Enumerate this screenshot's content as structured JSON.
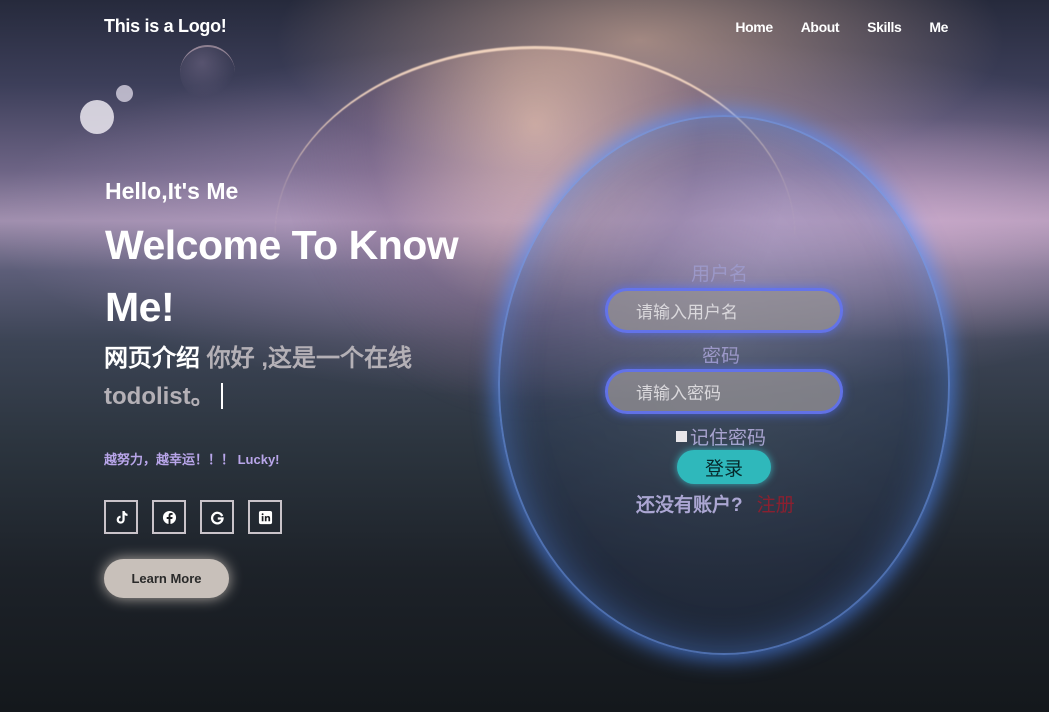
{
  "header": {
    "logo": "This is a Logo!",
    "nav": [
      "Home",
      "About",
      "Skills",
      "Me"
    ]
  },
  "hero": {
    "greeting": "Hello,It's Me",
    "title": "Welcome To Know Me!",
    "intro_label": "网页介绍",
    "intro_text": " 你好 ,这是一个在线todolist。",
    "motto": "越努力，越幸运！！！ Lucky!",
    "socials": [
      {
        "icon": "tiktok-icon"
      },
      {
        "icon": "facebook-icon"
      },
      {
        "icon": "google-icon"
      },
      {
        "icon": "linkedin-icon"
      }
    ],
    "learn_more": "Learn More"
  },
  "login": {
    "username_label": "用户名",
    "username_placeholder": "请输入用户名",
    "password_label": "密码",
    "password_placeholder": "请输入密码",
    "remember": "记住密码",
    "submit": "登录",
    "no_account": "还没有账户?",
    "register": "注册"
  },
  "colors": {
    "accent_purple": "#b9a6ea",
    "login_button": "#2fb8bb",
    "register_link": "#8a2030",
    "glow_blue": "#5a8cff"
  }
}
